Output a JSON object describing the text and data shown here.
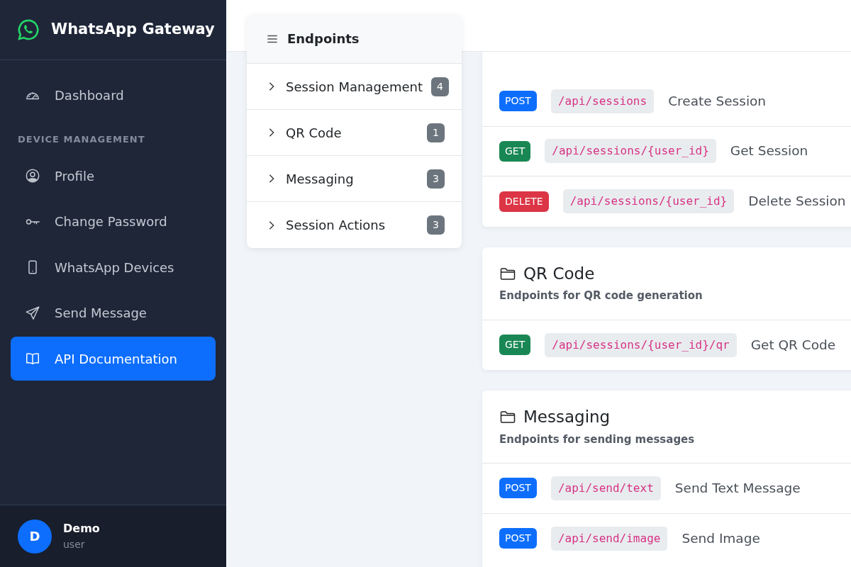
{
  "sidebar": {
    "brand": "WhatsApp Gateway",
    "items": [
      {
        "kind": "link",
        "label": "Dashboard",
        "selected": false
      },
      {
        "kind": "heading",
        "label": "DEVICE MANAGEMENT"
      },
      {
        "kind": "link",
        "label": "Profile",
        "selected": false
      },
      {
        "kind": "link",
        "label": "Change Password",
        "selected": false
      },
      {
        "kind": "link",
        "label": "WhatsApp Devices",
        "selected": false
      },
      {
        "kind": "link",
        "label": "Send Message",
        "selected": false
      },
      {
        "kind": "link",
        "label": "API Documentation",
        "selected": true
      }
    ],
    "user": {
      "initial": "D",
      "name": "Demo",
      "role": "user"
    }
  },
  "endpoints_nav": {
    "title": "Endpoints",
    "items": [
      {
        "label": "Session Management",
        "count": "4",
        "expanded": false
      },
      {
        "label": "QR Code",
        "count": "1",
        "expanded": false
      },
      {
        "label": "Messaging",
        "count": "3",
        "expanded": false
      },
      {
        "label": "Session Actions",
        "count": "3",
        "expanded": false
      }
    ]
  },
  "groups": [
    {
      "endpoints": [
        {
          "kind": "post",
          "method": "POST",
          "path": "/api/sessions",
          "summary": "Create Session"
        },
        {
          "kind": "get",
          "method": "GET",
          "path": "/api/sessions/{user_id}",
          "summary": "Get Session"
        },
        {
          "kind": "delete",
          "method": "DELETE",
          "path": "/api/sessions/{user_id}",
          "summary": "Delete Session"
        }
      ]
    },
    {
      "title": "QR Code",
      "description": "Endpoints for QR code generation",
      "endpoints": [
        {
          "kind": "get",
          "method": "GET",
          "path": "/api/sessions/{user_id}/qr",
          "summary": "Get QR Code"
        }
      ]
    },
    {
      "title": "Messaging",
      "description": "Endpoints for sending messages",
      "endpoints": [
        {
          "kind": "post",
          "method": "POST",
          "path": "/api/send/text",
          "summary": "Send Text Message"
        },
        {
          "kind": "post",
          "method": "POST",
          "path": "/api/send/image",
          "summary": "Send Image"
        }
      ]
    }
  ]
}
